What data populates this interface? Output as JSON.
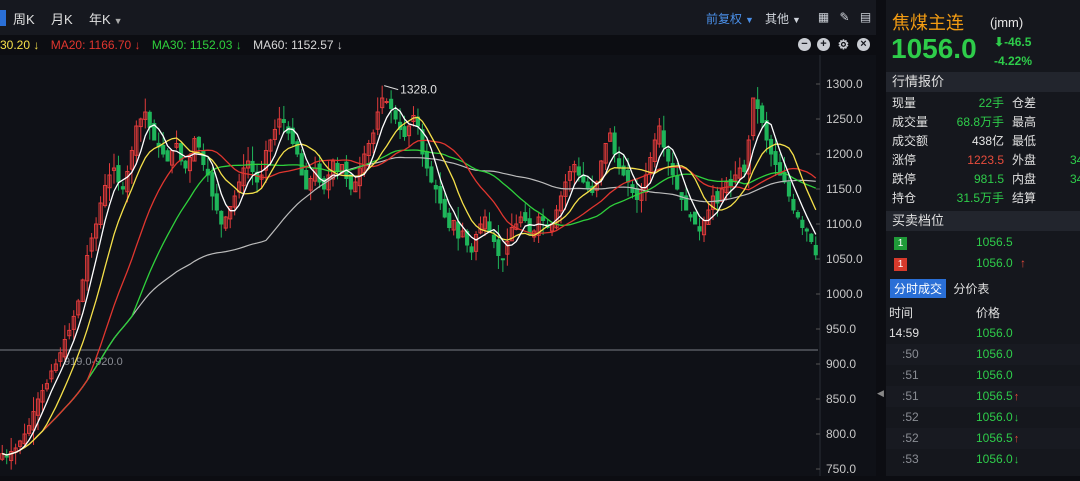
{
  "toolbar": {
    "tabs": [
      "周K",
      "月K",
      "年K"
    ],
    "adjust_label": "前复权",
    "other_label": "其他"
  },
  "ma_bar": {
    "ma_partial": "30.20 ↓",
    "ma20": "MA20: 1166.70 ↓",
    "ma30": "MA30: 1152.03 ↓",
    "ma60": "MA60: 1152.57 ↓"
  },
  "chart": {
    "high_label": "1328.0",
    "hline_label": "919.0-920.0",
    "y_ticks": [
      "1300.0",
      "1250.0",
      "1200.0",
      "1150.0",
      "1100.0",
      "1050.0",
      "1000.0",
      "950.0",
      "900.0",
      "850.0",
      "800.0",
      "750.0"
    ],
    "colors": {
      "up": "#e23b3b",
      "down": "#1fb55a",
      "white": "#ffffff",
      "yellow": "#f5e04a",
      "red": "#e0362f",
      "green": "#2fd13c",
      "gray": "#bcbcbc"
    }
  },
  "chart_data": {
    "type": "candlestick",
    "ylim": [
      740,
      1330
    ],
    "series": [
      {
        "name": "MA20",
        "value": 1166.7
      },
      {
        "name": "MA30",
        "value": 1152.03
      },
      {
        "name": "MA60",
        "value": 1152.57
      }
    ],
    "annotations": [
      {
        "label": "1328.0",
        "value": 1328.0
      },
      {
        "label": "919.0-920.0",
        "value": 920.0
      }
    ],
    "close_values": [
      772,
      768,
      775,
      780,
      790,
      800,
      812,
      832,
      850,
      862,
      872,
      890,
      900,
      916,
      935,
      948,
      968,
      990,
      1020,
      1055,
      1080,
      1100,
      1130,
      1155,
      1170,
      1180,
      1160,
      1150,
      1175,
      1205,
      1240,
      1250,
      1260,
      1238,
      1220,
      1210,
      1200,
      1190,
      1205,
      1215,
      1190,
      1180,
      1195,
      1222,
      1210,
      1185,
      1170,
      1140,
      1120,
      1100,
      1110,
      1125,
      1140,
      1160,
      1180,
      1190,
      1175,
      1160,
      1170,
      1205,
      1220,
      1235,
      1250,
      1245,
      1230,
      1215,
      1200,
      1170,
      1150,
      1165,
      1180,
      1160,
      1150,
      1170,
      1190,
      1175,
      1185,
      1165,
      1150,
      1160,
      1180,
      1200,
      1215,
      1230,
      1260,
      1280,
      1275,
      1265,
      1250,
      1235,
      1225,
      1240,
      1255,
      1240,
      1200,
      1180,
      1160,
      1150,
      1130,
      1110,
      1095,
      1105,
      1080,
      1090,
      1070,
      1060,
      1085,
      1100,
      1110,
      1090,
      1075,
      1055,
      1050,
      1075,
      1095,
      1100,
      1110,
      1105,
      1085,
      1090,
      1110,
      1105,
      1095,
      1100,
      1120,
      1140,
      1160,
      1175,
      1185,
      1170,
      1160,
      1150,
      1145,
      1160,
      1190,
      1215,
      1230,
      1200,
      1180,
      1170,
      1160,
      1145,
      1135,
      1150,
      1170,
      1195,
      1220,
      1240,
      1210,
      1190,
      1170,
      1150,
      1135,
      1120,
      1110,
      1100,
      1090,
      1105,
      1120,
      1140,
      1130,
      1150,
      1160,
      1155,
      1170,
      1180,
      1175,
      1220,
      1280,
      1265,
      1245,
      1220,
      1200,
      1185,
      1170,
      1160,
      1140,
      1120,
      1110,
      1095,
      1090,
      1075,
      1056
    ]
  },
  "panel": {
    "name": "焦煤主连",
    "code": "(jmm)",
    "price": "1056.0",
    "change": "-46.5",
    "change_pct": "-4.22%",
    "quote_header": "行情报价",
    "quote_rows": [
      {
        "l1": "现量",
        "v1": "22手",
        "c1": "green",
        "l2": "仓差",
        "v2": ""
      },
      {
        "l1": "成交量",
        "v1": "68.8万手",
        "c1": "green",
        "l2": "最高",
        "v2": ""
      },
      {
        "l1": "成交额",
        "v1": "438亿",
        "c1": "white",
        "l2": "最低",
        "v2": ""
      },
      {
        "l1": "涨停",
        "v1": "1223.5",
        "c1": "red",
        "l2": "外盘",
        "v2": "34"
      },
      {
        "l1": "跌停",
        "v1": "981.5",
        "c1": "green",
        "l2": "内盘",
        "v2": "34"
      },
      {
        "l1": "持仓",
        "v1": "31.5万手",
        "c1": "green",
        "l2": "结算",
        "v2": ""
      }
    ],
    "book_header": "买卖档位",
    "book": [
      {
        "tag": "1",
        "price": "1056.5",
        "arrow": "",
        "color": "green"
      },
      {
        "tag": "1",
        "price": "1056.0",
        "arrow": "↑",
        "color": "red"
      }
    ],
    "tab_active": "分时成交",
    "tab_other": "分价表",
    "col_time": "时间",
    "col_price": "价格",
    "trades": [
      {
        "time": "14:59",
        "price": "1056.0",
        "arrow": "",
        "arrow_color": ""
      },
      {
        "time": ":50",
        "price": "1056.0",
        "arrow": "",
        "arrow_color": ""
      },
      {
        "time": ":51",
        "price": "1056.0",
        "arrow": "",
        "arrow_color": ""
      },
      {
        "time": ":51",
        "price": "1056.5",
        "arrow": "↑",
        "arrow_color": "red"
      },
      {
        "time": ":52",
        "price": "1056.0",
        "arrow": "↓",
        "arrow_color": "green"
      },
      {
        "time": ":52",
        "price": "1056.5",
        "arrow": "↑",
        "arrow_color": "red"
      },
      {
        "time": ":53",
        "price": "1056.0",
        "arrow": "↓",
        "arrow_color": "green"
      }
    ]
  }
}
